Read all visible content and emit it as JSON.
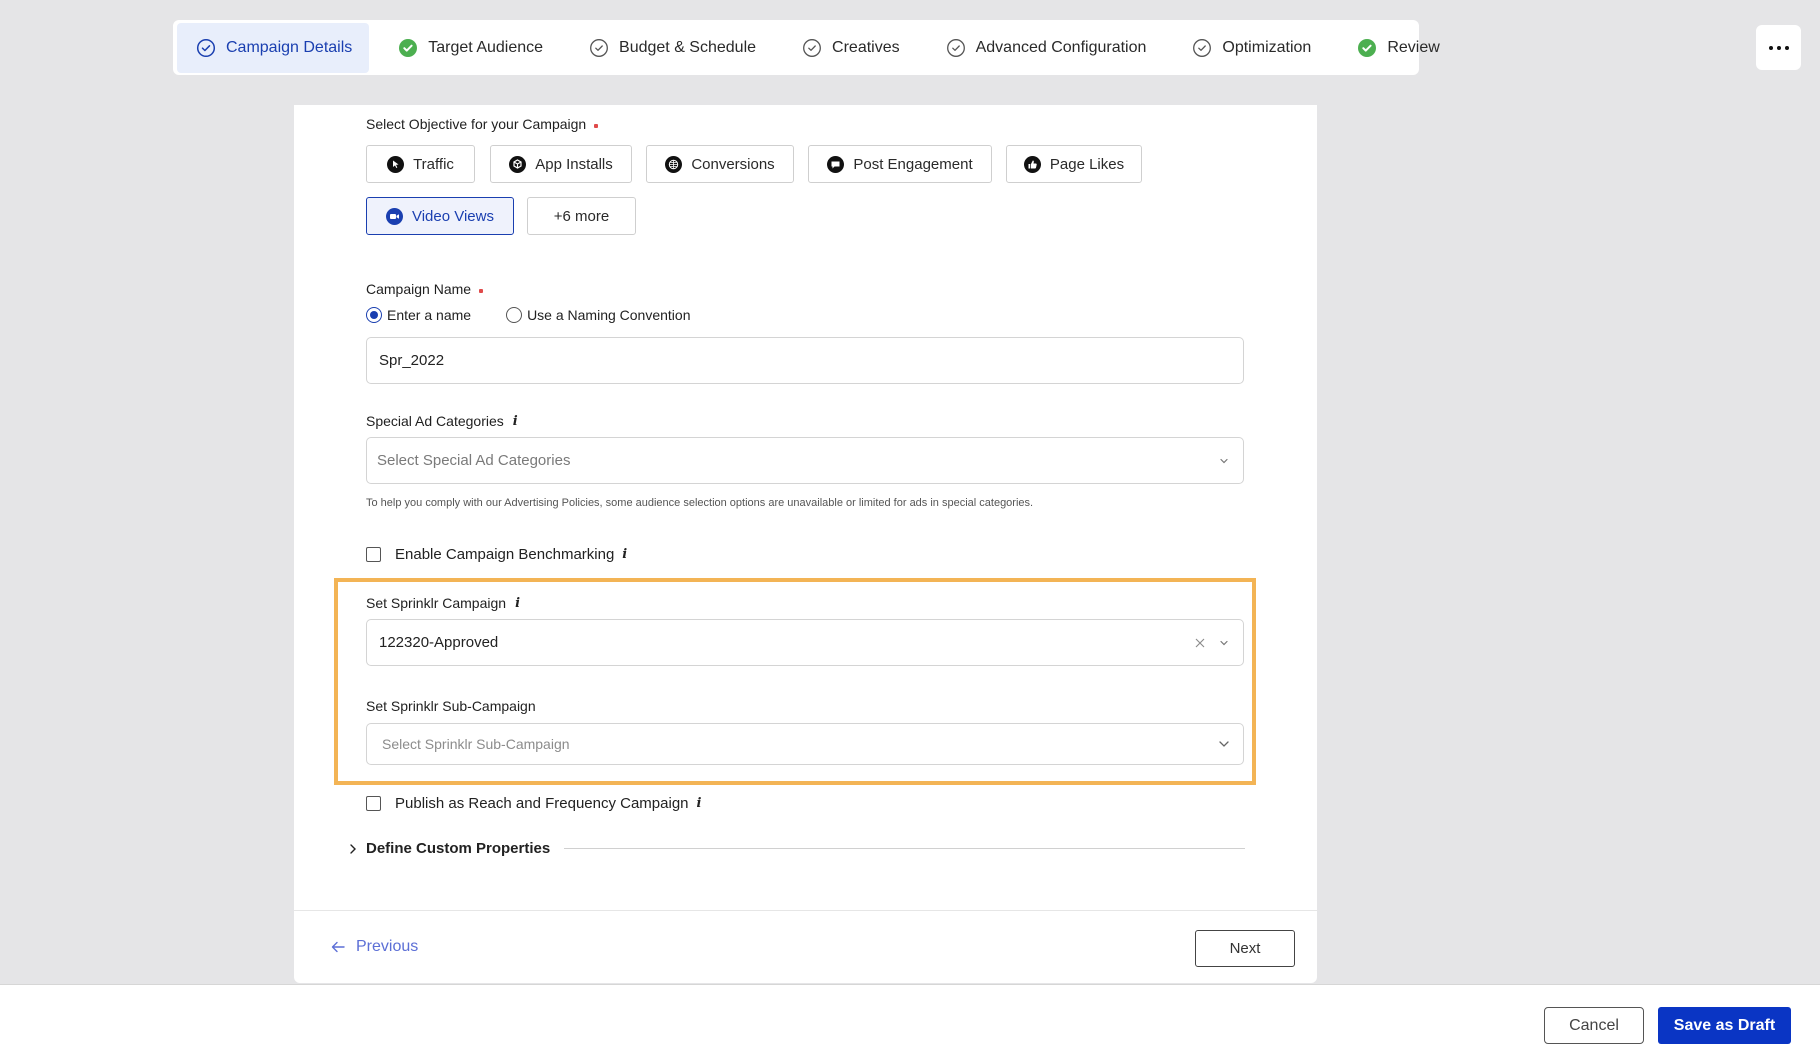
{
  "stepper": {
    "steps": [
      {
        "label": "Campaign Details",
        "status": "active",
        "icon": "check-circle-outline-icon"
      },
      {
        "label": "Target Audience",
        "status": "complete",
        "icon": "check-circle-filled-icon"
      },
      {
        "label": "Budget & Schedule",
        "status": "pending",
        "icon": "check-circle-outline-icon"
      },
      {
        "label": "Creatives",
        "status": "pending",
        "icon": "check-circle-outline-icon"
      },
      {
        "label": "Advanced Configuration",
        "status": "pending",
        "icon": "check-circle-outline-icon"
      },
      {
        "label": "Optimization",
        "status": "pending",
        "icon": "check-circle-outline-icon"
      },
      {
        "label": "Review",
        "status": "complete",
        "icon": "check-circle-filled-icon"
      }
    ],
    "more_menu_icon": "more-horizontal-icon"
  },
  "form": {
    "objective": {
      "label": "Select Objective for your Campaign",
      "required": true,
      "options": [
        {
          "label": "Traffic",
          "icon": "cursor-icon",
          "selected": false
        },
        {
          "label": "App Installs",
          "icon": "cube-icon",
          "selected": false
        },
        {
          "label": "Conversions",
          "icon": "globe-icon",
          "selected": false
        },
        {
          "label": "Post Engagement",
          "icon": "chat-icon",
          "selected": false
        },
        {
          "label": "Page Likes",
          "icon": "thumbs-up-icon",
          "selected": false
        },
        {
          "label": "Video Views",
          "icon": "video-camera-icon",
          "selected": true
        }
      ],
      "more_label": "+6 more"
    },
    "campaign_name": {
      "label": "Campaign Name",
      "required": true,
      "radio_options": [
        {
          "label": "Enter a name",
          "checked": true
        },
        {
          "label": "Use a Naming Convention",
          "checked": false
        }
      ],
      "value": "Spr_2022"
    },
    "special_ad_categories": {
      "label": "Special Ad Categories",
      "placeholder": "Select Special Ad Categories",
      "helper": "To help you comply with our Advertising Policies, some audience selection options are unavailable or limited for ads in special categories."
    },
    "benchmarking": {
      "label": "Enable Campaign Benchmarking",
      "checked": false
    },
    "sprinklr_campaign": {
      "label": "Set Sprinklr Campaign",
      "value": "122320-Approved"
    },
    "sprinklr_sub_campaign": {
      "label": "Set Sprinklr Sub-Campaign",
      "placeholder": "Select Sprinklr Sub-Campaign"
    },
    "reach_frequency": {
      "label": "Publish as Reach and Frequency Campaign",
      "checked": false
    },
    "custom_properties": {
      "label": "Define Custom Properties",
      "expanded": false
    }
  },
  "card_footer": {
    "previous_label": "Previous",
    "next_label": "Next"
  },
  "action_bar": {
    "cancel_label": "Cancel",
    "save_draft_label": "Save as Draft"
  },
  "colors": {
    "accent": "#1a3fb0",
    "primary_button": "#0a35c4",
    "success": "#4caf50",
    "highlight": "#f3b455",
    "required": "#e04a4a",
    "link": "#5c6fd6"
  }
}
